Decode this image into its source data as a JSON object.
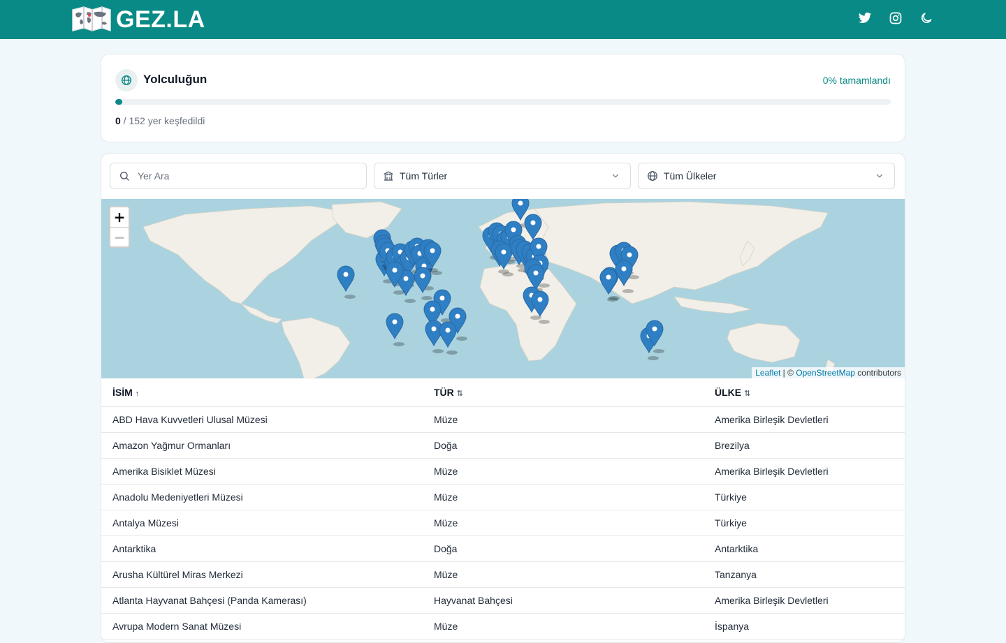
{
  "header": {
    "brand": "GEZ.LA",
    "icons": [
      "twitter-icon",
      "instagram-icon",
      "moon-icon"
    ]
  },
  "progress": {
    "title": "Yolculuğun",
    "percent_label": "0% tamamlandı",
    "fraction": 0.0,
    "visited": "0",
    "total_suffix": " / 152 yer keşfedildi"
  },
  "filters": {
    "search_placeholder": "Yer Ara",
    "type_label": "Tüm Türler",
    "country_label": "Tüm Ülkeler"
  },
  "map": {
    "zoom_in": "+",
    "zoom_out": "−",
    "attr_leaflet": "Leaflet",
    "attr_sep": " | © ",
    "attr_osm": "OpenStreetMap",
    "attr_suffix": " contributors"
  },
  "table": {
    "headers": [
      {
        "label": "İSİM",
        "sort": "↑"
      },
      {
        "label": "TÜR",
        "sort": "⇅"
      },
      {
        "label": "ÜLKE",
        "sort": "⇅"
      }
    ],
    "rows": [
      [
        "ABD Hava Kuvvetleri Ulusal Müzesi",
        "Müze",
        "Amerika Birleşik Devletleri"
      ],
      [
        "Amazon Yağmur Ormanları",
        "Doğa",
        "Brezilya"
      ],
      [
        "Amerika Bisiklet Müzesi",
        "Müze",
        "Amerika Birleşik Devletleri"
      ],
      [
        "Anadolu Medeniyetleri Müzesi",
        "Müze",
        "Türkiye"
      ],
      [
        "Antalya Müzesi",
        "Müze",
        "Türkiye"
      ],
      [
        "Antarktika",
        "Doğa",
        "Antarktika"
      ],
      [
        "Arusha Kültürel Miras Merkezi",
        "Müze",
        "Tanzanya"
      ],
      [
        "Atlanta Hayvanat Bahçesi (Panda Kamerası)",
        "Hayvanat Bahçesi",
        "Amerika Birleşik Devletleri"
      ],
      [
        "Avrupa Modern Sanat Müzesi",
        "Müze",
        "İspanya"
      ]
    ]
  },
  "colors": {
    "brand": "#0a8a86",
    "marker": "#2f7fc4",
    "water": "#aad3df",
    "land": "#f2efe9"
  }
}
